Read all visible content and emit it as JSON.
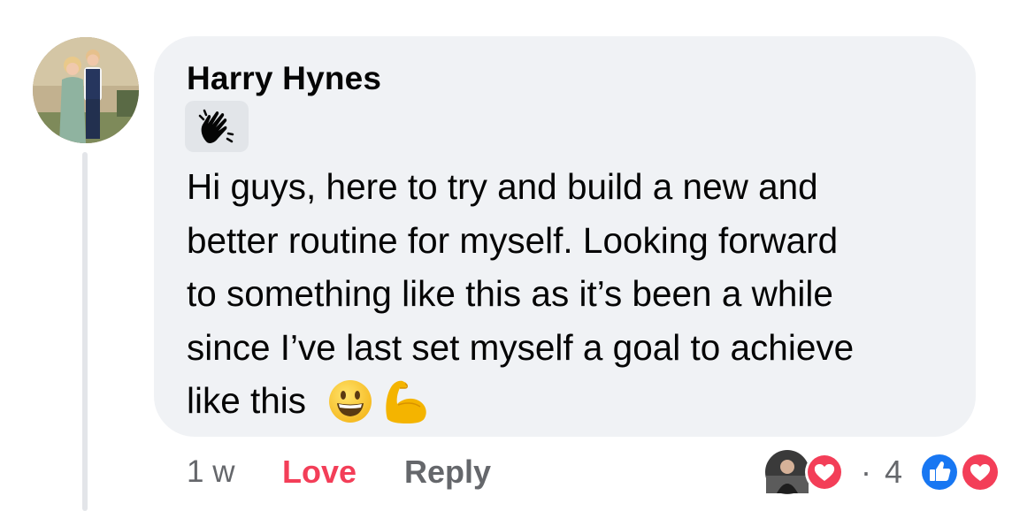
{
  "comment": {
    "author": "Harry Hynes",
    "badge_icon": "waving-hand-icon",
    "text": "Hi guys, here to try and build a new and\nbetter routine for myself. Looking forward\nto something like this as it’s been a while\nsince I’ve last set myself a goal to achieve\nlike this",
    "trailing_emojis": [
      "grinning-face-emoji",
      "flexed-biceps-emoji"
    ]
  },
  "actions": {
    "time": "1 w",
    "love_label": "Love",
    "reply_label": "Reply"
  },
  "reactions": {
    "separator": "·",
    "count": "4",
    "icons": [
      "reactor-avatar",
      "love-reaction-icon",
      "like-reaction-icon",
      "love-reaction-icon"
    ]
  },
  "colors": {
    "bubble": "#f0f2f5",
    "love": "#f33e58",
    "like": "#1877f2",
    "secondary_text": "#65676b"
  }
}
